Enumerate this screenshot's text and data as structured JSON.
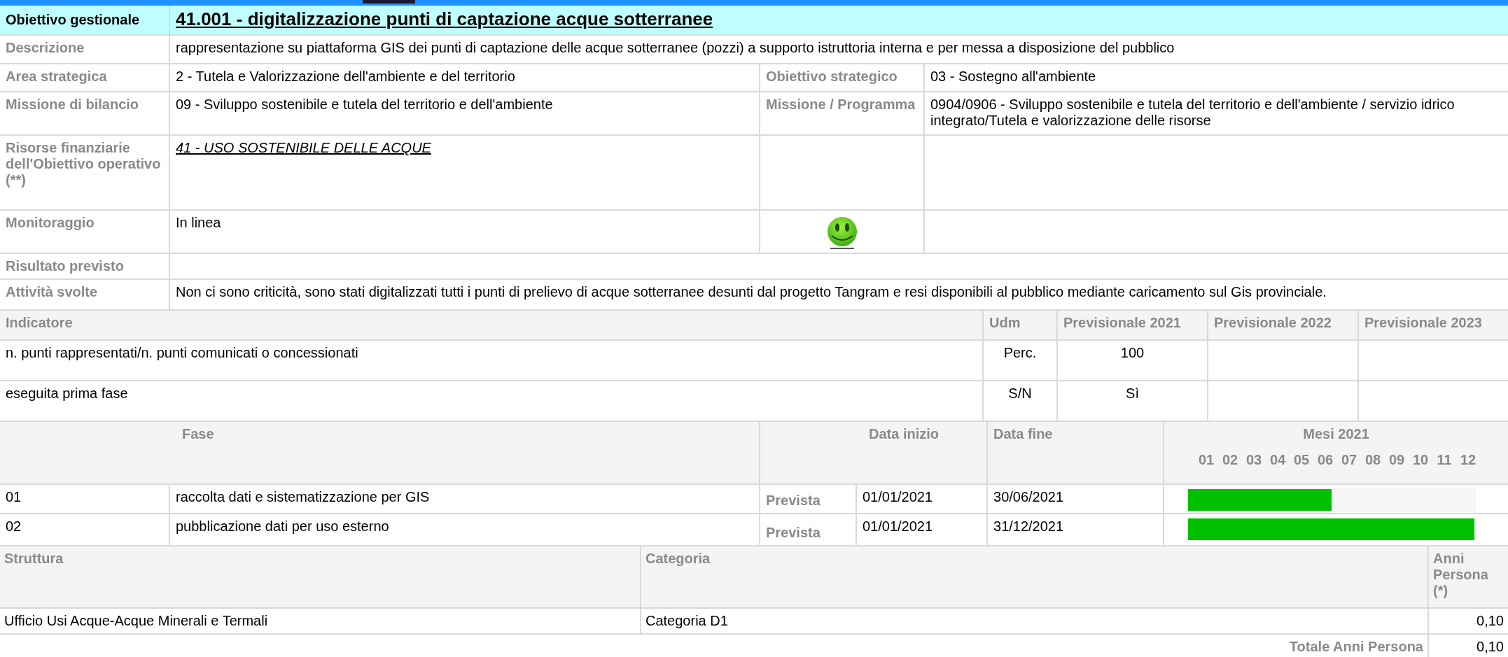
{
  "header": {
    "label": "Obiettivo gestionale",
    "title": "41.001 - digitalizzazione punti di captazione acque sotterranee"
  },
  "details": [
    {
      "kind": "wide",
      "label": "Descrizione",
      "value": "rappresentazione su piattaforma GIS dei punti di captazione delle acque sotterranee (pozzi) a supporto istruttoria interna e per messa a disposizione del pubblico"
    },
    {
      "kind": "pair",
      "label": "Area strategica",
      "value": "2 - Tutela e Valorizzazione dell'ambiente e del territorio",
      "label_2": "Obiettivo strategico",
      "value_2": "03 - Sostegno all'ambiente"
    },
    {
      "kind": "pair",
      "label": "Missione di bilancio",
      "value": "09 - Sviluppo sostenibile e tutela del territorio e dell'ambiente",
      "label_2": "Missione / Programma",
      "value_2": "0904/0906 - Sviluppo sostenibile e tutela del territorio e dell'ambiente / servizio idrico integrato/Tutela e valorizzazione delle risorse"
    },
    {
      "kind": "link",
      "label": "Risorse finanziarie dell'Obiettivo operativo (**)",
      "value": "41 - USO SOSTENIBILE DELLE ACQUE"
    },
    {
      "kind": "status",
      "label": "Monitoraggio",
      "value": "In linea"
    },
    {
      "kind": "wide",
      "label": "Risultato previsto"
    },
    {
      "kind": "wide",
      "label": "Attività svolte",
      "value": "Non ci sono criticità, sono stati digitalizzati tutti i punti di prelievo di acque sotterranee desunti dal progetto Tangram e resi disponibili al pubblico mediante caricamento sul Gis provinciale."
    }
  ],
  "indicators": {
    "columns": [
      "Indicatore",
      "Udm",
      "Previsionale 2021",
      "Previsionale 2022",
      "Previsionale 2023"
    ],
    "rows": [
      {
        "indicator": "n. punti rappresentati/n. punti comunicati o concessionati",
        "udm": "Perc.",
        "forecast_2021": "100"
      },
      {
        "indicator": "eseguita prima fase",
        "udm": "S/N",
        "forecast_2021": "Sì"
      }
    ]
  },
  "phases": {
    "columns": [
      "Fase",
      "Data inizio",
      "Data fine"
    ],
    "months_title": "Mesi 2021",
    "months": [
      "01",
      "02",
      "03",
      "04",
      "05",
      "06",
      "07",
      "08",
      "09",
      "10",
      "11",
      "12"
    ],
    "rows": [
      {
        "number": "01",
        "name": "raccolta dati e sistematizzazione per  GIS",
        "type": "Prevista",
        "start": "01/01/2021",
        "end": "30/06/2021",
        "level": 0.5
      },
      {
        "number": "02",
        "name": "pubblicazione dati per uso esterno",
        "type": "Prevista",
        "start": "01/01/2021",
        "end": "31/12/2021",
        "level": 1
      }
    ]
  },
  "staff": {
    "columns": [
      "Struttura",
      "Categoria",
      "Anni Persona (*)"
    ],
    "rows": [
      {
        "structure": "Ufficio Usi Acque-Acque Minerali e Termali",
        "category": "Categoria D1",
        "years": "0,10"
      }
    ],
    "total": {
      "label": "Totale Anni Persona",
      "value": "0,10"
    }
  }
}
